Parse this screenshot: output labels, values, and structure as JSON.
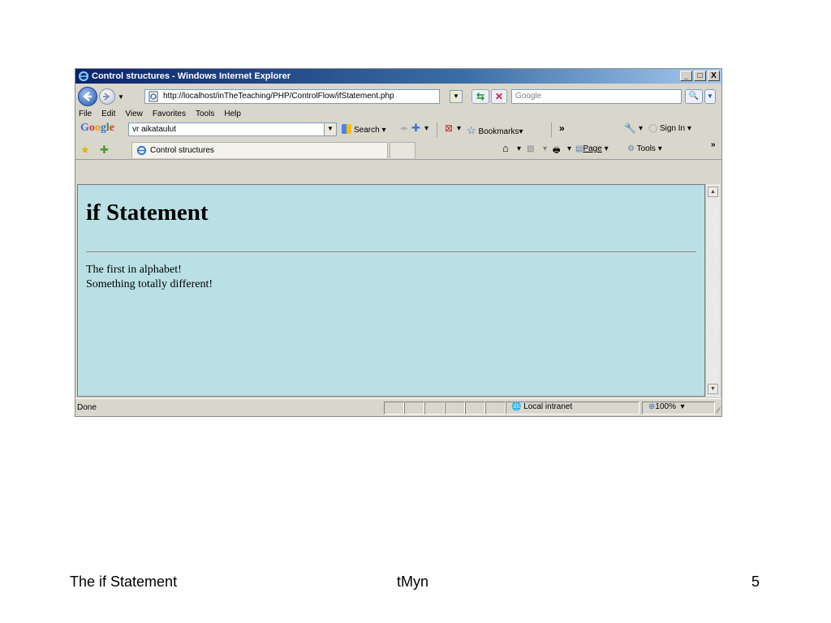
{
  "window": {
    "title": "Control structures - Windows Internet Explorer",
    "controls": {
      "minimize": "_",
      "maximize": "□",
      "close": "X"
    }
  },
  "address_bar": {
    "url": "http://localhost/inTheTeaching/PHP/ControlFlow/ifStatement.php",
    "search_placeholder": "Google"
  },
  "menu": [
    "File",
    "Edit",
    "View",
    "Favorites",
    "Tools",
    "Help"
  ],
  "google_toolbar": {
    "logo": "Google",
    "query": "vr aikataulut",
    "search_label": "Search",
    "bookmarks_label": "Bookmarks",
    "more": "»",
    "sign_in": "Sign In"
  },
  "favorites_bar": {
    "tab_title": "Control structures",
    "page_label": "Page",
    "tools_label": "Tools",
    "more": "»"
  },
  "page": {
    "heading": "if Statement",
    "lines": [
      "The first in alphabet!",
      "Something totally different!"
    ],
    "background": "#b9e0e4"
  },
  "status_bar": {
    "text": "Done",
    "zone": "Local intranet",
    "zoom": "100%"
  },
  "slide_footer": {
    "left": "The if Statement",
    "center": "tMyn",
    "right": "5"
  }
}
